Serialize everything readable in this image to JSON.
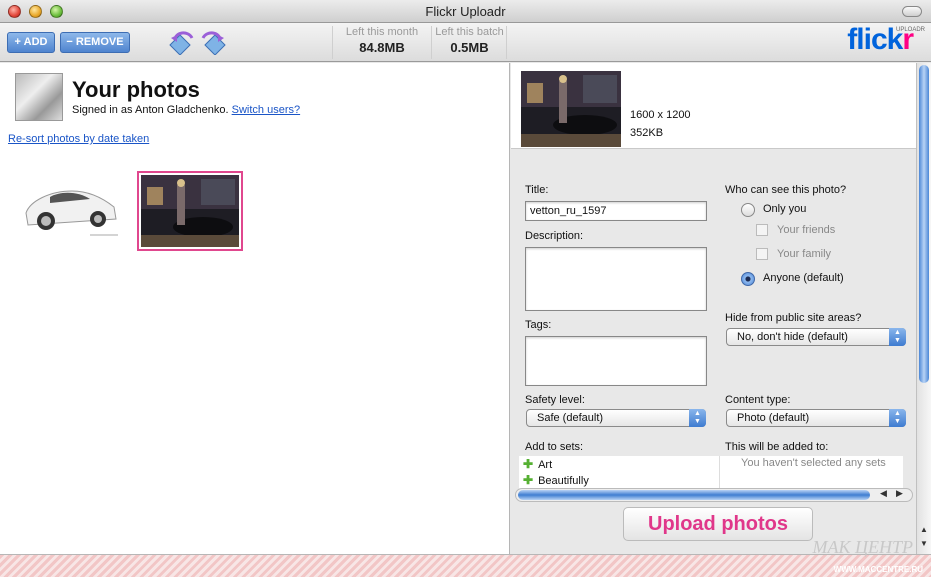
{
  "window": {
    "title": "Flickr Uploadr"
  },
  "toolbar": {
    "add_label": "+ ADD",
    "remove_label": "− REMOVE",
    "left_this_month_label": "Left this month",
    "left_this_month_value": "84.8MB",
    "left_this_batch_label": "Left this batch",
    "left_this_batch_value": "0.5MB",
    "logo_part1": "flick",
    "logo_part2": "r",
    "logo_tag": "UPLOADR"
  },
  "left": {
    "heading": "Your photos",
    "signed_in_prefix": "Signed in as Anton Gladchenko.",
    "switch_users": "Switch users?",
    "resort_link": "Re-sort photos by date taken"
  },
  "preview": {
    "dimensions": "1600 x 1200",
    "file_size": "352KB"
  },
  "form": {
    "title_label": "Title:",
    "title_value": "vetton_ru_1597",
    "description_label": "Description:",
    "tags_label": "Tags:",
    "safety_label": "Safety level:",
    "safety_value": "Safe (default)",
    "add_to_sets_label": "Add to sets:",
    "sets": [
      "Art",
      "Beautifully"
    ],
    "privacy_label": "Who can see this photo?",
    "only_you": "Only you",
    "your_friends": "Your friends",
    "your_family": "Your family",
    "anyone": "Anyone (default)",
    "hide_label": "Hide from public site areas?",
    "hide_value": "No, don't hide (default)",
    "content_type_label": "Content type:",
    "content_type_value": "Photo (default)",
    "added_to_label": "This will be added to:",
    "no_sets_text": "You haven't selected any sets"
  },
  "upload_button": "Upload photos",
  "watermark": {
    "text": "MAK ЦЕНТР",
    "url": "WWW.MACCENTRE.RU"
  },
  "colors": {
    "flickr_blue": "#0063dc",
    "flickr_pink": "#ff0084",
    "selection_border": "#e0478e"
  }
}
